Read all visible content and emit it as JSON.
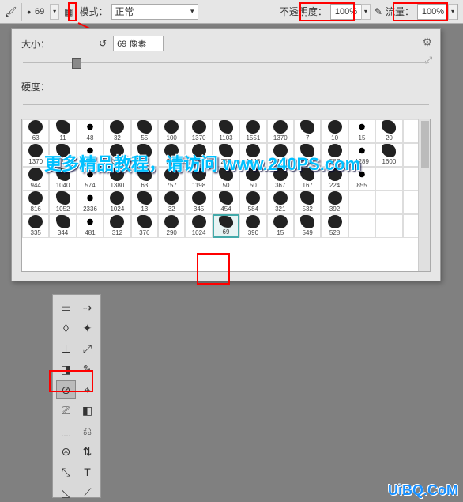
{
  "toolbar": {
    "size_value": "69",
    "mode_label": "模式：",
    "mode_value": "正常",
    "opacity_label": "不透明度：",
    "opacity_value": "100%",
    "flow_label": "流量：",
    "flow_value": "100%"
  },
  "panel": {
    "size_label": "大小：",
    "size_value": "69 像素",
    "hardness_label": "硬度：",
    "gear_icon": "⚙",
    "corner_icon": "⤢"
  },
  "brushes": [
    {
      "n": "63"
    },
    {
      "n": "11"
    },
    {
      "n": "48"
    },
    {
      "n": "32"
    },
    {
      "n": "55"
    },
    {
      "n": "100"
    },
    {
      "n": "1370"
    },
    {
      "n": "1103"
    },
    {
      "n": "1551"
    },
    {
      "n": "1370"
    },
    {
      "n": "7"
    },
    {
      "n": "10"
    },
    {
      "n": "15"
    },
    {
      "n": "20"
    },
    {
      "n": ""
    },
    {
      "n": "1370"
    },
    {
      "n": "111"
    },
    {
      "n": "232"
    },
    {
      "n": "377"
    },
    {
      "n": "102"
    },
    {
      "n": "252"
    },
    {
      "n": "252"
    },
    {
      "n": "252"
    },
    {
      "n": "1448"
    },
    {
      "n": "15"
    },
    {
      "n": "612"
    },
    {
      "n": "587"
    },
    {
      "n": "1289"
    },
    {
      "n": "1600"
    },
    {
      "n": ""
    },
    {
      "n": "944"
    },
    {
      "n": "1040"
    },
    {
      "n": "574"
    },
    {
      "n": "1380"
    },
    {
      "n": "63"
    },
    {
      "n": "757"
    },
    {
      "n": "1198"
    },
    {
      "n": "50"
    },
    {
      "n": "50"
    },
    {
      "n": "367"
    },
    {
      "n": "167"
    },
    {
      "n": "224"
    },
    {
      "n": "855"
    },
    {
      "n": ""
    },
    {
      "n": ""
    },
    {
      "n": "816"
    },
    {
      "n": "1052"
    },
    {
      "n": "2336"
    },
    {
      "n": "1024"
    },
    {
      "n": "13"
    },
    {
      "n": "32"
    },
    {
      "n": "345"
    },
    {
      "n": "454"
    },
    {
      "n": "584"
    },
    {
      "n": "321"
    },
    {
      "n": "532"
    },
    {
      "n": "392"
    },
    {
      "n": ""
    },
    {
      "n": ""
    },
    {
      "n": ""
    },
    {
      "n": "335"
    },
    {
      "n": "344"
    },
    {
      "n": "481"
    },
    {
      "n": "312"
    },
    {
      "n": "376"
    },
    {
      "n": "290"
    },
    {
      "n": "1024"
    },
    {
      "n": "69",
      "sel": true
    },
    {
      "n": "390"
    },
    {
      "n": "15"
    },
    {
      "n": "549"
    },
    {
      "n": "528"
    },
    {
      "n": ""
    },
    {
      "n": ""
    },
    {
      "n": ""
    }
  ],
  "tools": [
    "▭",
    "⇢",
    "◊",
    "✦",
    "⟂",
    "⤢",
    "◨",
    "✎",
    "⊘",
    "⌖",
    "⎚",
    "◧",
    "⬚",
    "⎌",
    "⊛",
    "⇅",
    "⤡",
    "T",
    "◺",
    "⟋"
  ],
  "watermarks": {
    "main": "更多精品教程，请访问 www.240PS.com",
    "corner": "UiBQ.CoM"
  }
}
